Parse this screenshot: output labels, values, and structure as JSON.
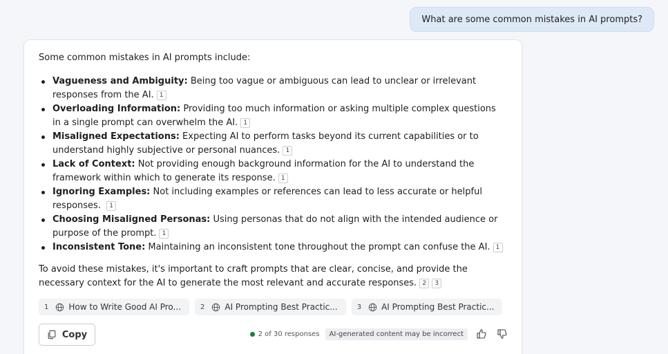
{
  "user_message": "What are some common mistakes in AI prompts?",
  "answer": {
    "intro": "Some common mistakes in AI prompts include:",
    "items": [
      {
        "term": "Vagueness and Ambiguity:",
        "text": " Being too vague or ambiguous can lead to unclear or irrelevant responses from the AI.",
        "cite": "1"
      },
      {
        "term": "Overloading Information:",
        "text": " Providing too much information or asking multiple complex questions in a single prompt can overwhelm the AI.",
        "cite": "1"
      },
      {
        "term": "Misaligned Expectations:",
        "text": " Expecting AI to perform tasks beyond its current capabilities or to understand highly subjective or personal nuances.",
        "cite": "1"
      },
      {
        "term": "Lack of Context:",
        "text": " Not providing enough background information for the AI to understand the framework within which to generate its response.",
        "cite": "1"
      },
      {
        "term": "Ignoring Examples:",
        "text": " Not including examples or references can lead to less accurate or helpful responses.",
        "cite": "1"
      },
      {
        "term": "Choosing Misaligned Personas:",
        "text": " Using personas that do not align with the intended audience or purpose of the prompt.",
        "cite": "1"
      },
      {
        "term": "Inconsistent Tone:",
        "text": " Maintaining an inconsistent tone throughout the prompt can confuse the AI.",
        "cite": "1"
      }
    ],
    "closing": "To avoid these mistakes, it's important to craft prompts that are clear, concise, and provide the necessary context for the AI to generate the most relevant and accurate responses.",
    "closing_cites": [
      "2",
      "3"
    ]
  },
  "sources": [
    {
      "num": "1",
      "title": "How to Write Good AI Pro...",
      "icon": "globe-icon"
    },
    {
      "num": "2",
      "title": "AI Prompting Best Practic...",
      "icon": "globe-icon"
    },
    {
      "num": "3",
      "title": "AI Prompting Best Practic...",
      "icon": "globe-icon"
    }
  ],
  "footer": {
    "copy_label": "Copy",
    "responses": "2 of 30 responses",
    "disclaimer": "AI-generated content may be incorrect",
    "status_color": "#1a7f37"
  }
}
